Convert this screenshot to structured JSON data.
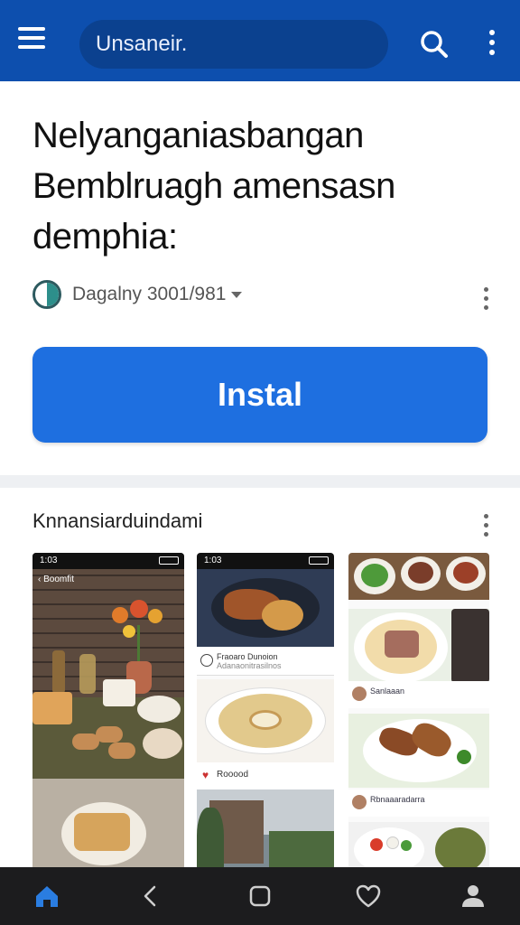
{
  "appbar": {
    "search_text": "Unsaneir.",
    "menu_icon": "menu-icon",
    "search_icon": "search-icon",
    "more_icon": "more-vert-icon",
    "color": "#0d4fae"
  },
  "app": {
    "title": "Nelyanganiasbangan Bemblruagh amensasn demphia:",
    "developer": "Dagalny 3001/981",
    "install_label": "Instal",
    "install_color": "#1e6fe0"
  },
  "gallery": {
    "title": "Knnansiarduindami",
    "shot1": {
      "status_time": "1:03",
      "header": "Boomfit"
    },
    "shot2": {
      "status_time": "1:03",
      "post_title": "Fraoaro Dunoion",
      "post_sub": "Adanaonitrasilnos",
      "caption": "Rooood"
    },
    "shot3": {
      "caption1": "Sanlaaan",
      "caption2": "Rbnaaaradarra"
    }
  },
  "navbar": {
    "items": [
      "home-icon",
      "back-icon",
      "recents-icon",
      "heart-icon",
      "profile-icon"
    ],
    "active_color": "#2a7de1"
  }
}
